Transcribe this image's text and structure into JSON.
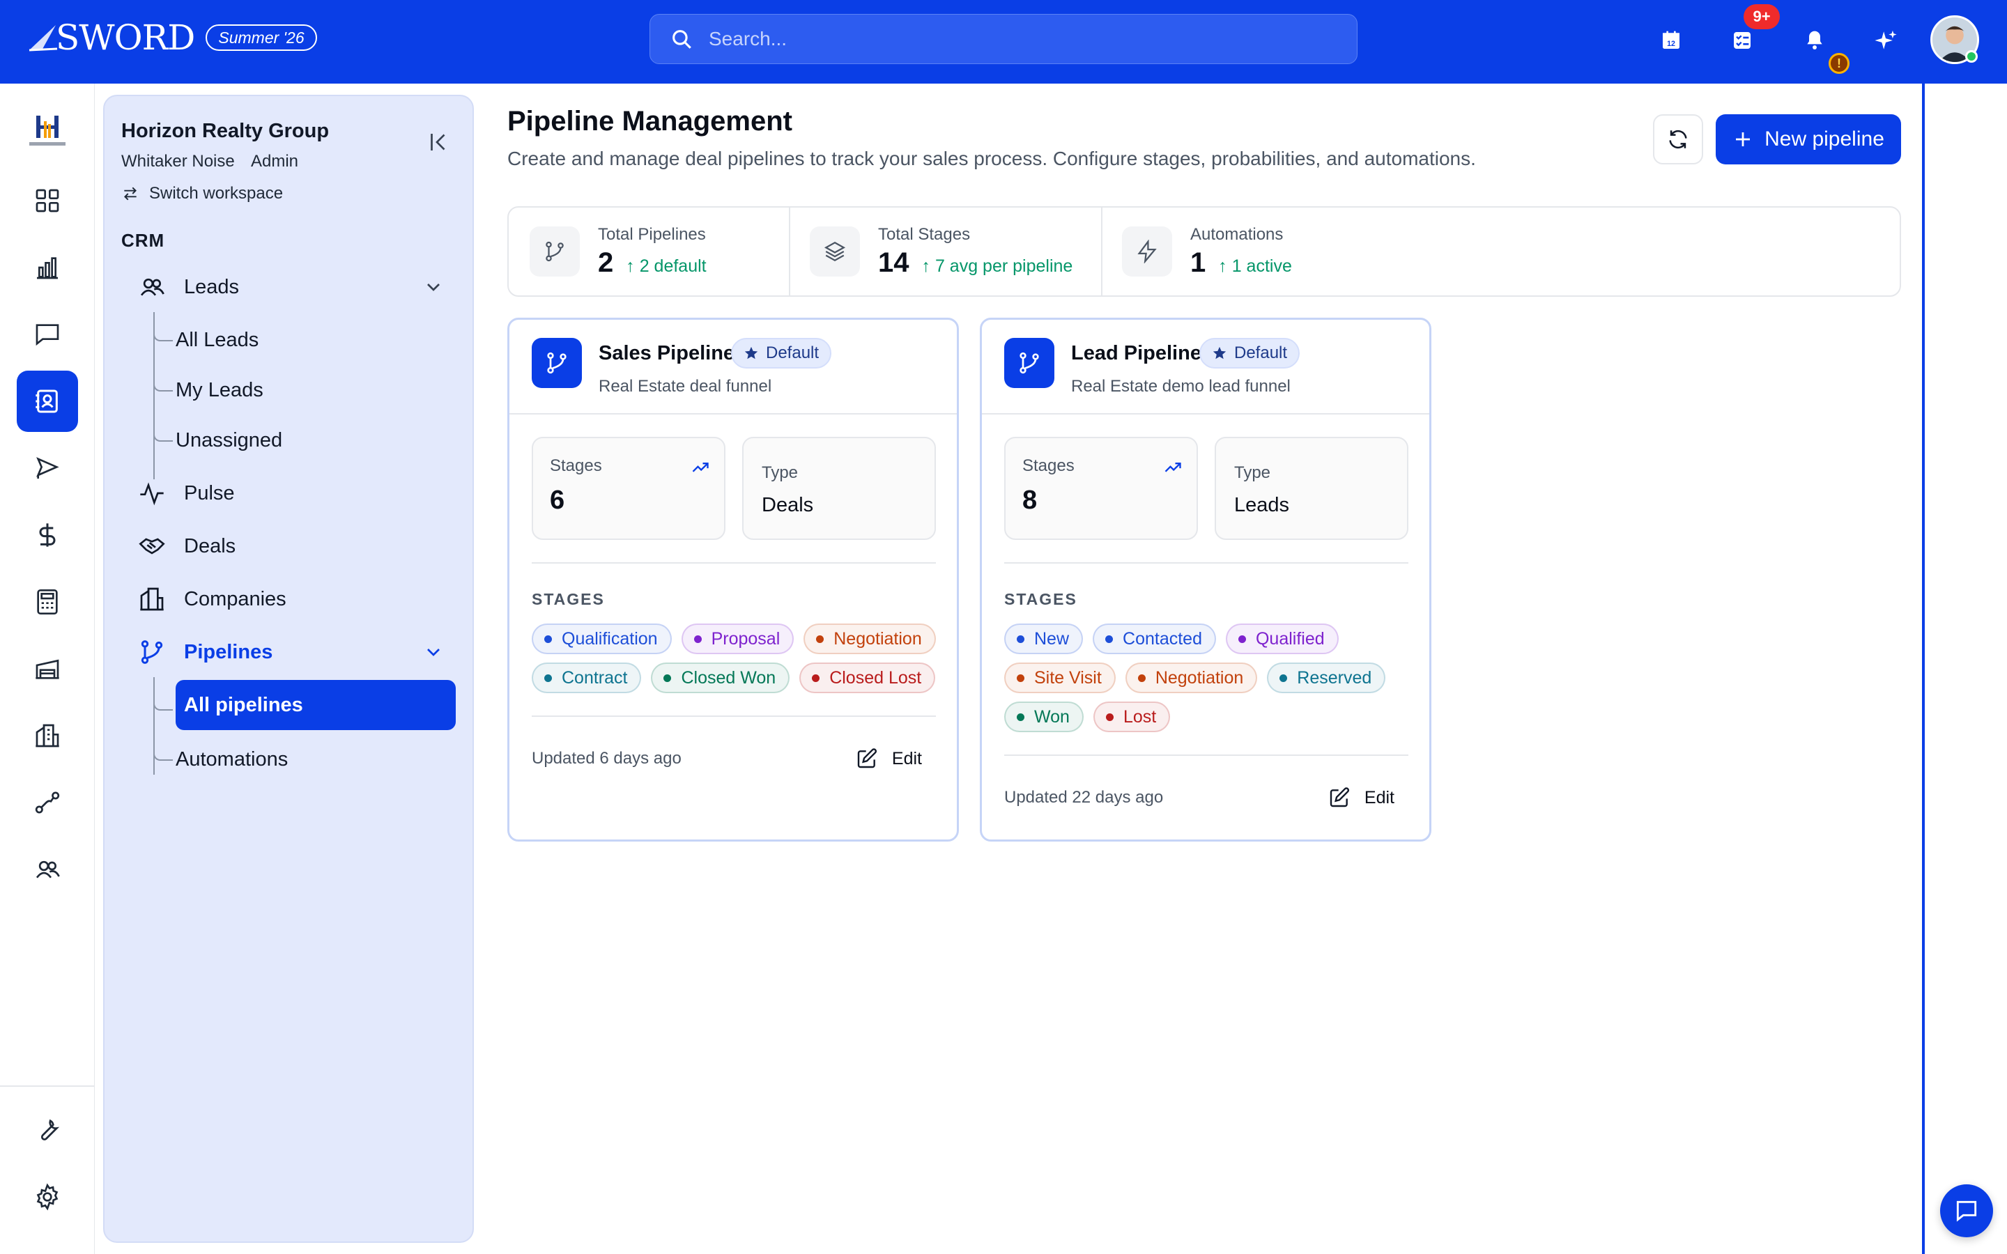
{
  "app": {
    "logo_text": "SWORD",
    "release_badge": "Summer '26"
  },
  "search": {
    "placeholder": "Search..."
  },
  "topbar": {
    "notification_count": "9+",
    "alert_glyph": "!",
    "icons": [
      "calendar-icon",
      "tasks-icon",
      "bell-icon",
      "sparkle-icon"
    ]
  },
  "rail": {
    "items": [
      "dashboard-icon",
      "analytics-icon",
      "messages-icon",
      "contacts-icon",
      "campaign-icon",
      "finance-icon",
      "calculator-icon",
      "warehouse-icon",
      "buildings-icon",
      "route-icon",
      "team-icon"
    ],
    "bottom_items": [
      "tools-icon",
      "settings-icon"
    ],
    "active": "contacts-icon"
  },
  "sidebar": {
    "org_name": "Horizon Realty Group",
    "user_name": "Whitaker Noise",
    "user_role": "Admin",
    "switch_workspace": "Switch workspace",
    "section": "CRM",
    "leads": "Leads",
    "leads_children": [
      "All Leads",
      "My Leads",
      "Unassigned"
    ],
    "pulse": "Pulse",
    "deals": "Deals",
    "companies": "Companies",
    "pipelines": "Pipelines",
    "pipelines_children": [
      "All pipelines",
      "Automations"
    ]
  },
  "header": {
    "title": "Pipeline Management",
    "subtitle": "Create and manage deal pipelines to track your sales process. Configure stages, probabilities, and automations.",
    "new_button": "New pipeline"
  },
  "stats": [
    {
      "label": "Total Pipelines",
      "value": "2",
      "trend": "↑ 2 default",
      "icon": "pipeline-icon"
    },
    {
      "label": "Total Stages",
      "value": "14",
      "trend": "↑ 7 avg per pipeline",
      "icon": "layers-icon"
    },
    {
      "label": "Automations",
      "value": "1",
      "trend": "↑ 1 active",
      "icon": "bolt-icon"
    }
  ],
  "pipelines": [
    {
      "name": "Sales Pipeline",
      "badge": "Default",
      "description": "Real Estate deal funnel",
      "stages_label": "Stages",
      "stages_count": "6",
      "type_label": "Type",
      "type_value": "Deals",
      "stages_heading": "STAGES",
      "stages": [
        {
          "label": "Qualification",
          "color": "#1d4ed8"
        },
        {
          "label": "Proposal",
          "color": "#7e22ce"
        },
        {
          "label": "Negotiation",
          "color": "#c2410c"
        },
        {
          "label": "Contract",
          "color": "#0e7490"
        },
        {
          "label": "Closed Won",
          "color": "#047857"
        },
        {
          "label": "Closed Lost",
          "color": "#b91c1c"
        }
      ],
      "updated": "Updated 6 days ago",
      "edit": "Edit"
    },
    {
      "name": "Lead Pipeline",
      "badge": "Default",
      "description": "Real Estate demo lead funnel",
      "stages_label": "Stages",
      "stages_count": "8",
      "type_label": "Type",
      "type_value": "Leads",
      "stages_heading": "STAGES",
      "stages": [
        {
          "label": "New",
          "color": "#1d4ed8"
        },
        {
          "label": "Contacted",
          "color": "#1d4ed8"
        },
        {
          "label": "Qualified",
          "color": "#7e22ce"
        },
        {
          "label": "Site Visit",
          "color": "#c2410c"
        },
        {
          "label": "Negotiation",
          "color": "#c2410c"
        },
        {
          "label": "Reserved",
          "color": "#0e7490"
        },
        {
          "label": "Won",
          "color": "#047857"
        },
        {
          "label": "Lost",
          "color": "#b91c1c"
        }
      ],
      "updated": "Updated 22 days ago",
      "edit": "Edit"
    }
  ],
  "colors": {
    "brand": "#0a3ee6",
    "sidebar_bg": "#e3e9fc",
    "trend_green": "#059669"
  }
}
